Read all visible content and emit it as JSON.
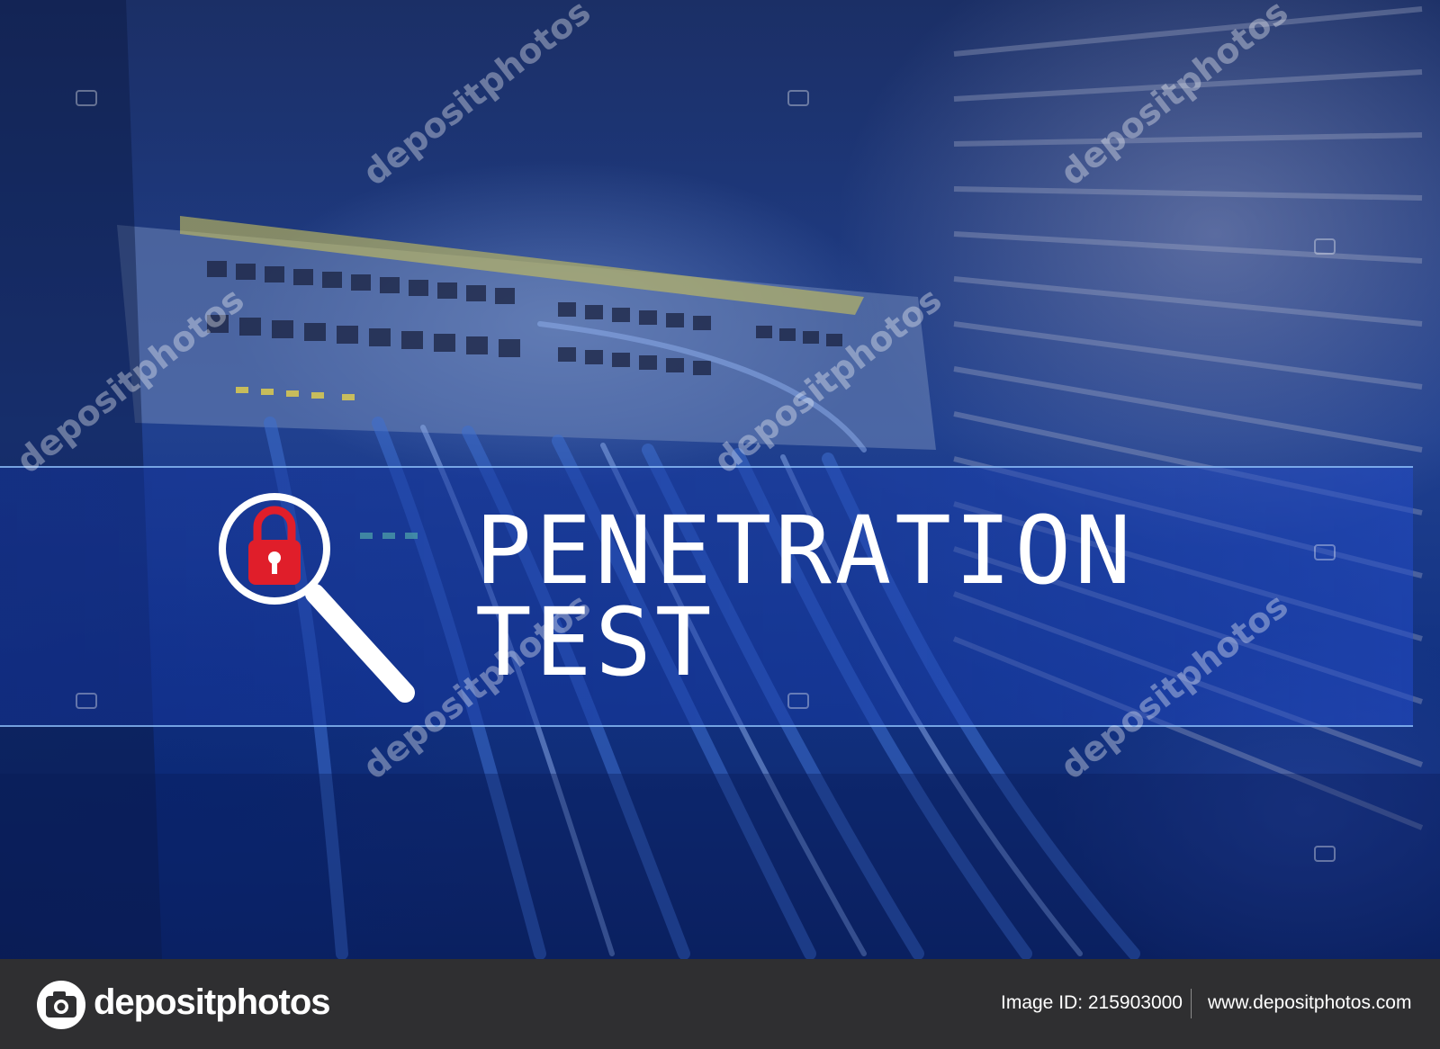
{
  "banner": {
    "line1": "PENETRATION",
    "line2": "TEST",
    "icon": "magnifier-lock-icon",
    "lock_color": "#e01e2a",
    "band_border_color": "#96c8ff"
  },
  "watermark": {
    "text": "depositphotos"
  },
  "footer": {
    "brand": "depositphotos",
    "logo_icon": "camera-icon",
    "image_id": "Image ID: 215903000",
    "url": "www.depositphotos.com",
    "background": "#2f2f31"
  }
}
